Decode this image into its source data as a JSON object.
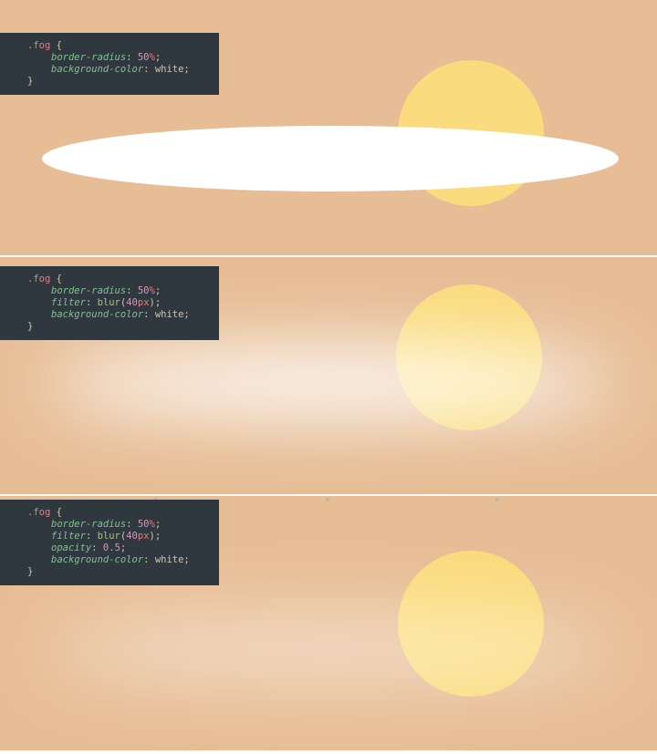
{
  "panels": [
    {
      "code": {
        "selector": ".fog",
        "decls": [
          {
            "prop": "border-radius",
            "value_num": "50",
            "value_unit": "%"
          },
          {
            "prop": "background-color",
            "value_ident": "white"
          }
        ]
      }
    },
    {
      "code": {
        "selector": ".fog",
        "decls": [
          {
            "prop": "border-radius",
            "value_num": "50",
            "value_unit": "%"
          },
          {
            "prop": "filter",
            "value_fn": "blur",
            "value_num": "40",
            "value_unit": "px"
          },
          {
            "prop": "background-color",
            "value_ident": "white"
          }
        ]
      }
    },
    {
      "code": {
        "selector": ".fog",
        "decls": [
          {
            "prop": "border-radius",
            "value_num": "50",
            "value_unit": "%"
          },
          {
            "prop": "filter",
            "value_fn": "blur",
            "value_num": "40",
            "value_unit": "px"
          },
          {
            "prop": "opacity",
            "value_num": "0.5"
          },
          {
            "prop": "background-color",
            "value_ident": "white"
          }
        ]
      }
    }
  ],
  "guide_marks": [
    "×",
    "×",
    "×"
  ]
}
